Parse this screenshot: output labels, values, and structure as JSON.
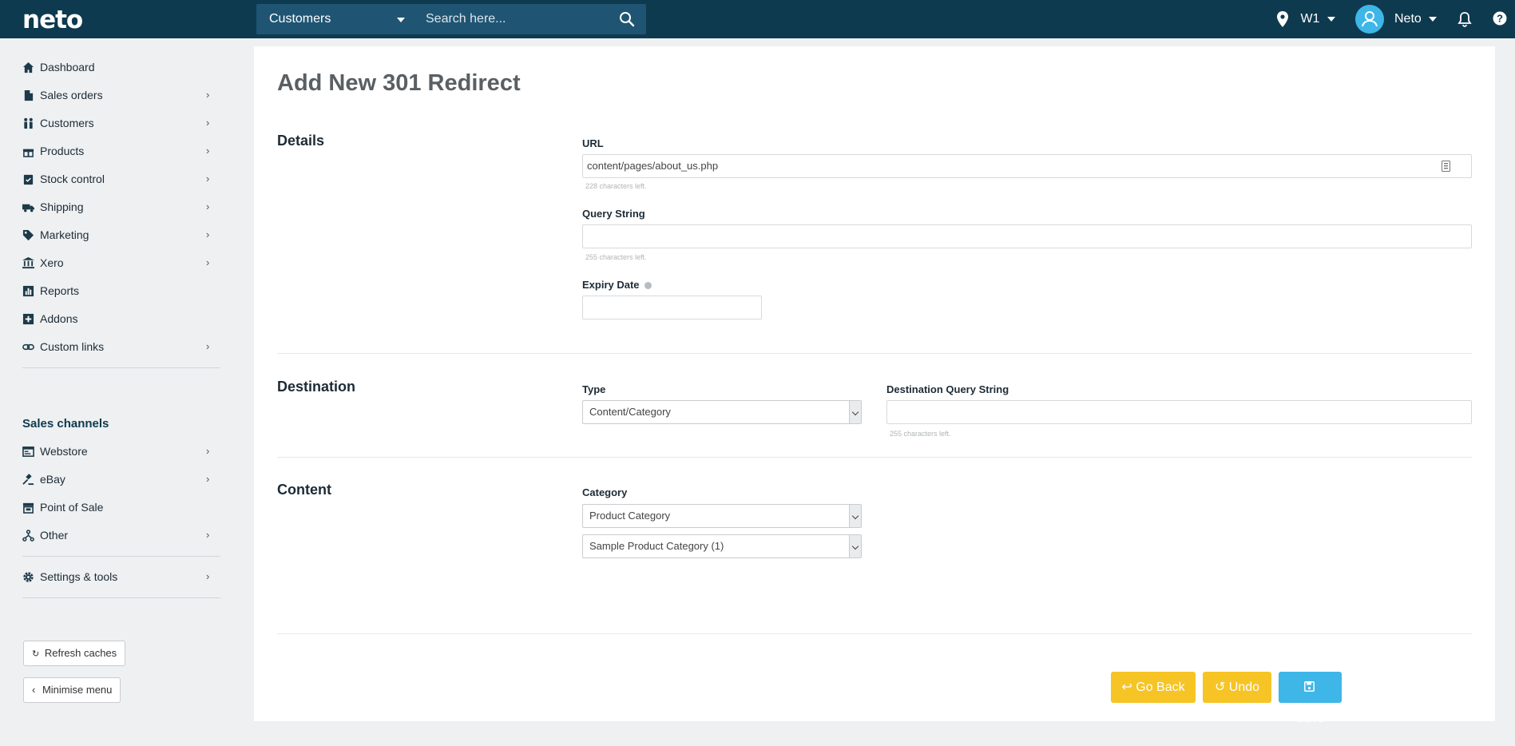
{
  "topbar": {
    "logo": "neto",
    "search_scope": "Customers",
    "search_placeholder": "Search here...",
    "location": "W1",
    "user": "Neto"
  },
  "sidebar": {
    "items": [
      {
        "label": "Dashboard",
        "icon": "home-icon",
        "chevron": false
      },
      {
        "label": "Sales orders",
        "icon": "document-icon",
        "chevron": true
      },
      {
        "label": "Customers",
        "icon": "people-icon",
        "chevron": true
      },
      {
        "label": "Products",
        "icon": "gift-icon",
        "chevron": true
      },
      {
        "label": "Stock control",
        "icon": "clipboard-check-icon",
        "chevron": true
      },
      {
        "label": "Shipping",
        "icon": "truck-icon",
        "chevron": true
      },
      {
        "label": "Marketing",
        "icon": "tag-icon",
        "chevron": true
      },
      {
        "label": "Xero",
        "icon": "bank-icon",
        "chevron": true
      },
      {
        "label": "Reports",
        "icon": "bar-chart-icon",
        "chevron": false
      },
      {
        "label": "Addons",
        "icon": "plus-square-icon",
        "chevron": false
      },
      {
        "label": "Custom links",
        "icon": "link-icon",
        "chevron": true
      }
    ],
    "channels_title": "Sales channels",
    "channels": [
      {
        "label": "Webstore",
        "icon": "webstore-icon",
        "chevron": true
      },
      {
        "label": "eBay",
        "icon": "gavel-icon",
        "chevron": true
      },
      {
        "label": "Point of Sale",
        "icon": "store-icon",
        "chevron": false
      },
      {
        "label": "Other",
        "icon": "branch-icon",
        "chevron": true
      }
    ],
    "settings": {
      "label": "Settings & tools",
      "icon": "gear-icon",
      "chevron": true
    },
    "refresh_label": "Refresh caches",
    "minimise_label": "Minimise menu"
  },
  "main": {
    "title": "Add New 301 Redirect",
    "details": {
      "heading": "Details",
      "url_label": "URL",
      "url_value": "content/pages/about_us.php",
      "url_hint": "228 characters left.",
      "query_label": "Query String",
      "query_value": "",
      "query_hint": "255 characters left.",
      "expiry_label": "Expiry Date",
      "expiry_value": ""
    },
    "destination": {
      "heading": "Destination",
      "type_label": "Type",
      "type_value": "Content/Category",
      "dest_query_label": "Destination Query String",
      "dest_query_value": "",
      "dest_query_hint": "255 characters left."
    },
    "content": {
      "heading": "Content",
      "category_label": "Category",
      "category_type_value": "Product Category",
      "category_value": "Sample Product Category (1)"
    },
    "actions": {
      "go_back": "Go Back",
      "undo": "Undo",
      "save": "Save"
    }
  },
  "colors": {
    "topbar": "#0e3a4f",
    "accent_yellow": "#f6c425",
    "accent_blue": "#3eb6e8"
  }
}
